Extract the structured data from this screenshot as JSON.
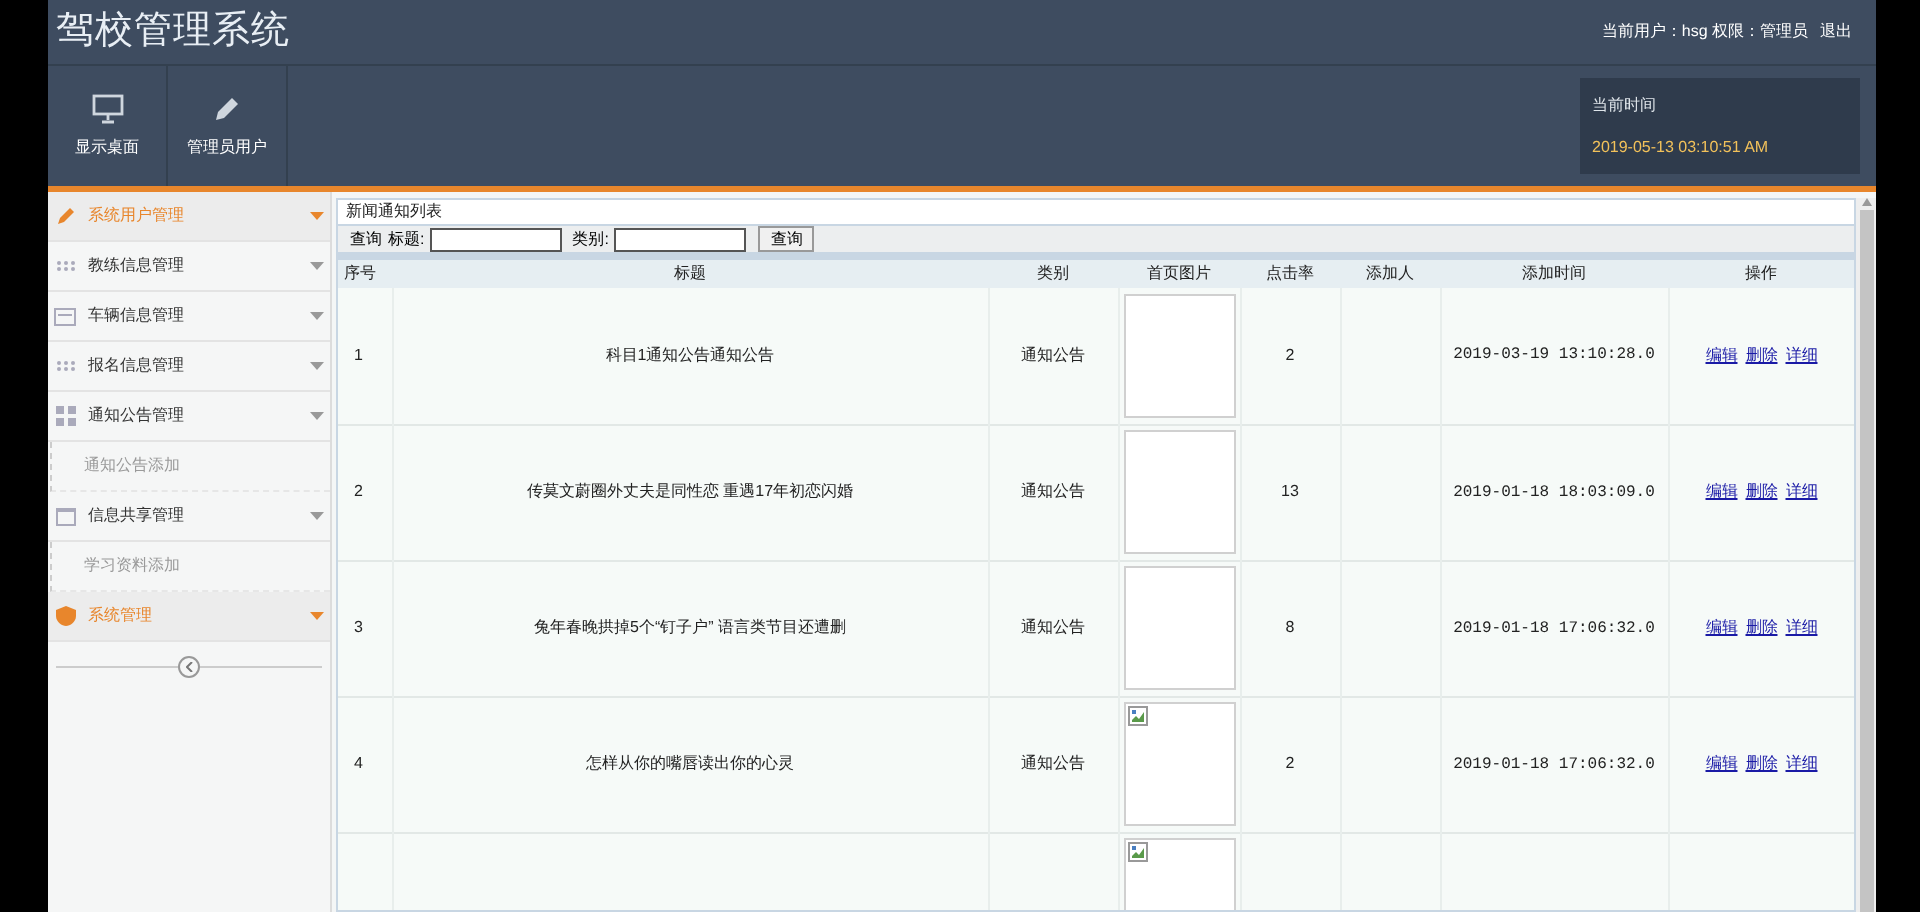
{
  "header": {
    "title": "驾校管理系统",
    "user": "当前用户：hsg 权限：管理员",
    "logout": "退出",
    "shortcuts": [
      {
        "label": "显示桌面"
      },
      {
        "label": "管理员用户"
      }
    ],
    "clock": {
      "label": "当前时间",
      "value": "2019-05-13 03:10:51 AM"
    }
  },
  "sidebar": {
    "items": [
      {
        "kind": "group",
        "label": "系统用户管理",
        "highlighted": true
      },
      {
        "kind": "group",
        "label": "教练信息管理",
        "highlighted": false
      },
      {
        "kind": "group",
        "label": "车辆信息管理",
        "highlighted": false
      },
      {
        "kind": "group",
        "label": "报名信息管理",
        "highlighted": false
      },
      {
        "kind": "group",
        "label": "通知公告管理",
        "highlighted": false
      },
      {
        "kind": "sub",
        "label": "通知公告添加",
        "highlighted": false
      },
      {
        "kind": "group",
        "label": "信息共享管理",
        "highlighted": false
      },
      {
        "kind": "sub",
        "label": "学习资料添加",
        "highlighted": false
      },
      {
        "kind": "group",
        "label": "系统管理",
        "highlighted": true
      }
    ]
  },
  "panel": {
    "title": "新闻通知列表",
    "search": {
      "label": "查询",
      "title_label": "标题:",
      "category_label": "类别:",
      "button": "查询"
    },
    "table": {
      "columns": [
        "序号",
        "标题",
        "类别",
        "首页图片",
        "点击率",
        "添加人",
        "添加时间",
        "操作"
      ],
      "rows": [
        {
          "index": "1",
          "title": "科目1通知公告通知公告",
          "category": "通知公告",
          "image_broken": false,
          "clicks": "2",
          "added_by": "",
          "time": "2019-03-19 13:10:28.0",
          "actions": [
            "编辑",
            "删除",
            "详细"
          ]
        },
        {
          "index": "2",
          "title": "传莫文蔚圈外丈夫是同性恋 重遇17年初恋闪婚",
          "category": "通知公告",
          "image_broken": false,
          "clicks": "13",
          "added_by": "",
          "time": "2019-01-18 18:03:09.0",
          "actions": [
            "编辑",
            "删除",
            "详细"
          ]
        },
        {
          "index": "3",
          "title": "兔年春晚拱掉5个“钉子户” 语言类节目还遭删",
          "category": "通知公告",
          "image_broken": false,
          "clicks": "8",
          "added_by": "",
          "time": "2019-01-18 17:06:32.0",
          "actions": [
            "编辑",
            "删除",
            "详细"
          ]
        },
        {
          "index": "4",
          "title": "怎样从你的嘴唇读出你的心灵",
          "category": "通知公告",
          "image_broken": true,
          "clicks": "2",
          "added_by": "",
          "time": "2019-01-18 17:06:32.0",
          "actions": [
            "编辑",
            "删除",
            "详细"
          ]
        },
        {
          "image_broken": true
        }
      ]
    }
  }
}
